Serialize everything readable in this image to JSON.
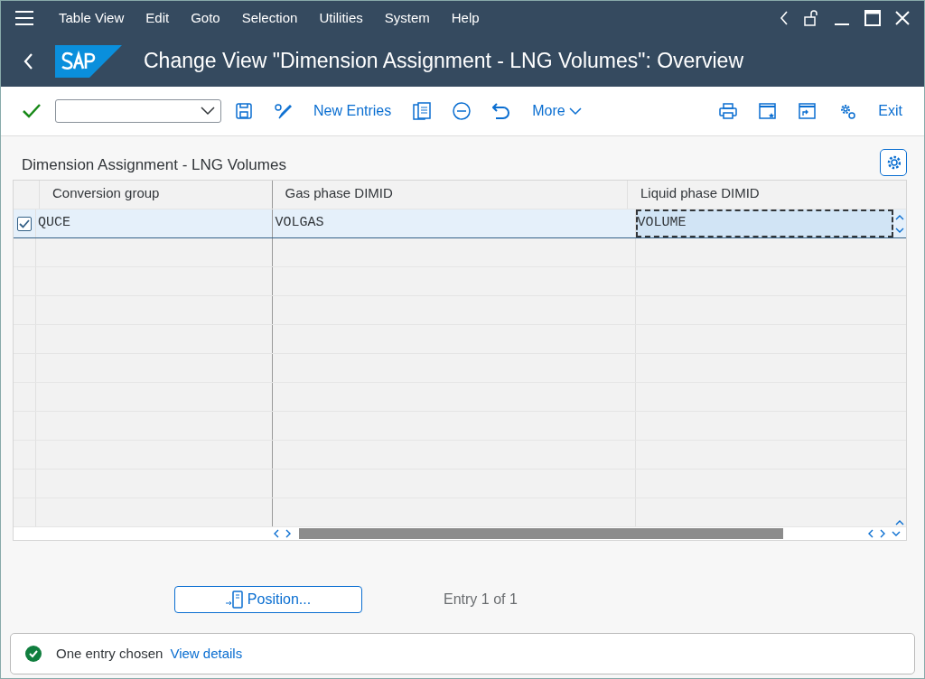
{
  "menu": [
    "Table View",
    "Edit",
    "Goto",
    "Selection",
    "Utilities",
    "System",
    "Help"
  ],
  "title": "Change View \"Dimension Assignment - LNG Volumes\": Overview",
  "toolbar": {
    "new_entries": "New Entries",
    "more": "More",
    "exit": "Exit"
  },
  "table": {
    "title": "Dimension Assignment - LNG Volumes",
    "columns": [
      "Conversion group",
      "Gas phase DIMID",
      "Liquid phase DIMID"
    ],
    "rows": [
      {
        "selected": true,
        "cells": [
          {
            "text": "QUCE",
            "focused": false
          },
          {
            "text": "VOLGAS",
            "focused": false
          },
          {
            "text": "VOLUME",
            "focused": true
          }
        ]
      }
    ]
  },
  "position_button": "Position...",
  "entry_count": "Entry 1 of 1",
  "status": {
    "message": "One entry chosen",
    "link": "View details"
  }
}
